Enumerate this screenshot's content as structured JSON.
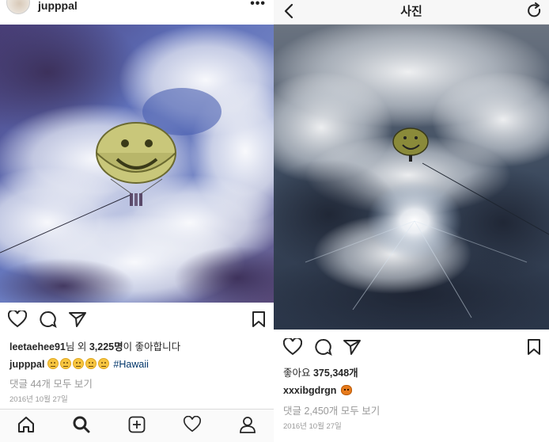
{
  "left": {
    "username": "jupppal",
    "more_icon": "•••",
    "likes_prefix_user": "leetaehee91",
    "likes_mid": "님 외 ",
    "likes_count": "3,225명",
    "likes_suffix": "이 좋아합니다",
    "caption_user": "jupppal",
    "caption_emojis": 5,
    "hashtag": "#Hawaii",
    "comments": "댓글 44개 모두 보기",
    "date": "2016년 10월 27일",
    "nav": [
      "home-icon",
      "search-icon",
      "add-icon",
      "heart-icon",
      "profile-icon"
    ]
  },
  "right": {
    "title": "사진",
    "likes_label": "좋아요 ",
    "likes_count": "375,348개",
    "caption_user": "xxxibgdrgn",
    "comments": "댓글 2,450개 모두 보기",
    "date": "2016년 10월 27일"
  },
  "colors": {
    "text": "#262626",
    "muted": "#999999",
    "hashtag": "#003569",
    "sky_blue": "#3f59a8",
    "parachute": "#c7c77a"
  }
}
